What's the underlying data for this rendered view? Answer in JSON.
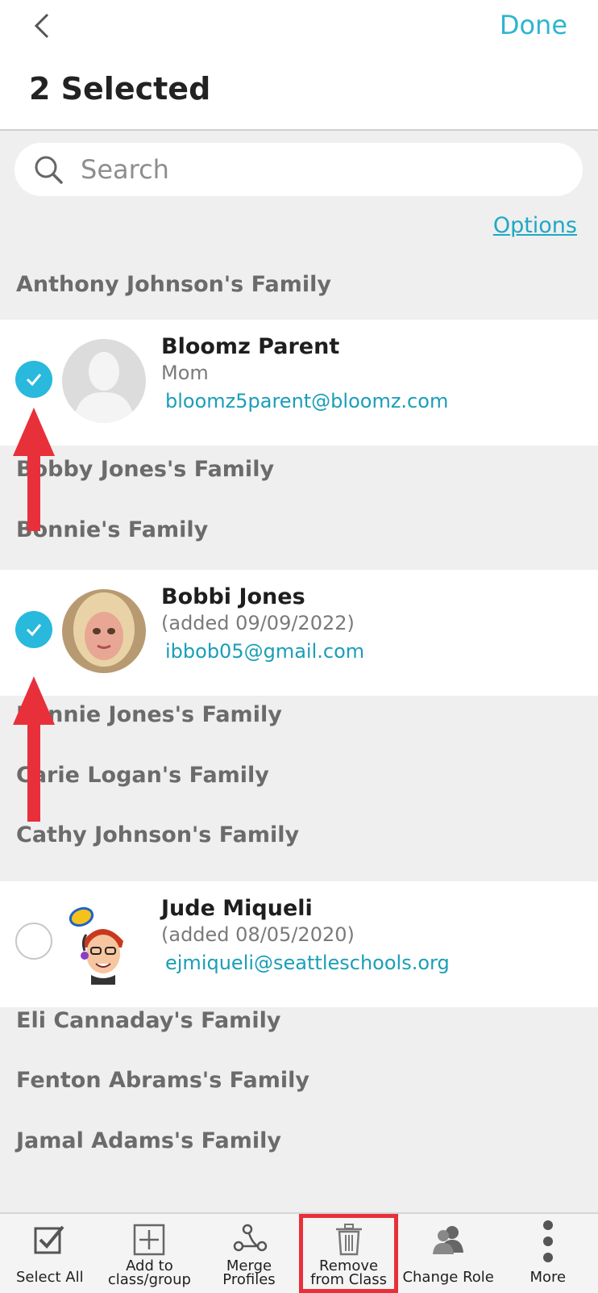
{
  "header": {
    "done_label": "Done",
    "title": "2 Selected"
  },
  "search": {
    "placeholder": "Search",
    "value": ""
  },
  "options_label": "Options",
  "families": [
    "Anthony Johnson's Family",
    "Bobby Jones's Family",
    "Bonnie's Family",
    "Bonnie Jones's Family",
    "Carie Logan's Family",
    "Cathy Johnson's Family",
    "Eli Cannaday's Family",
    "Fenton Abrams's Family",
    "Jamal Adams's Family"
  ],
  "members": [
    {
      "name": "Bloomz Parent",
      "subtitle": "Mom",
      "email": "bloomz5parent@bloomz.com",
      "selected": true
    },
    {
      "name": "Bobbi Jones",
      "subtitle": "(added 09/09/2022)",
      "email": "ibbob05@gmail.com",
      "selected": true
    },
    {
      "name": "Jude Miqueli",
      "subtitle": "(added 08/05/2020)",
      "email": "ejmiqueli@seattleschools.org",
      "selected": false
    }
  ],
  "toolbar": {
    "select_all": "Select All",
    "add_to_line1": "Add to",
    "add_to_line2": "class/group",
    "merge_line1": "Merge",
    "merge_line2": "Profiles",
    "remove_line1": "Remove",
    "remove_line2": "from Class",
    "change_role": "Change Role",
    "more": "More"
  },
  "colors": {
    "accent": "#2cb5cf",
    "check": "#28b9dd",
    "annotation": "#e8303a"
  }
}
